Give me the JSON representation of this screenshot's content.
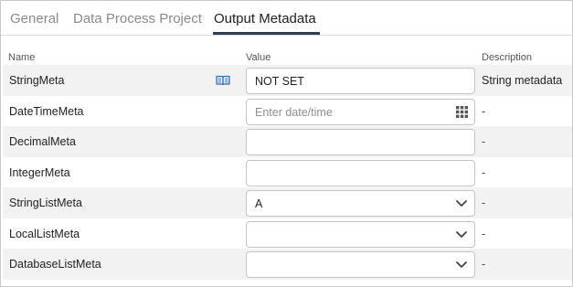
{
  "tabs": [
    {
      "label": "General"
    },
    {
      "label": "Data Process Project"
    },
    {
      "label": "Output Metadata",
      "active": true
    }
  ],
  "columns": {
    "name": "Name",
    "value": "Value",
    "description": "Description"
  },
  "rows": [
    {
      "name": "StringMeta",
      "value": "NOT SET",
      "description": "String metadata",
      "control": "text",
      "icon": "book-icon"
    },
    {
      "name": "DateTimeMeta",
      "placeholder": "Enter date/time",
      "description": "-",
      "control": "date",
      "icon": "calendar-grid-icon"
    },
    {
      "name": "DecimalMeta",
      "value": "",
      "description": "-",
      "control": "text"
    },
    {
      "name": "IntegerMeta",
      "value": "",
      "description": "-",
      "control": "text"
    },
    {
      "name": "StringListMeta",
      "value": "A",
      "description": "-",
      "control": "select",
      "icon": "chevron-down-icon"
    },
    {
      "name": "LocalListMeta",
      "value": "",
      "description": "-",
      "control": "select",
      "icon": "chevron-down-icon"
    },
    {
      "name": "DatabaseListMeta",
      "value": "",
      "description": "-",
      "control": "select",
      "icon": "chevron-down-icon"
    }
  ],
  "colors": {
    "accent": "#2f3e55",
    "row_alt": "#f2f2f2",
    "border": "#c4c4c4",
    "book_icon": "#2a6db3"
  }
}
